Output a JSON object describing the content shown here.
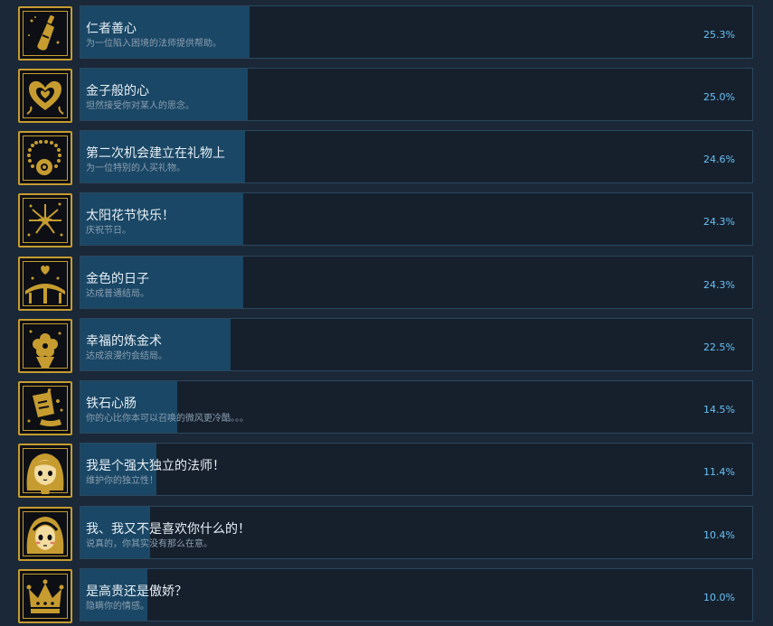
{
  "achievements": [
    {
      "title": "仁者善心",
      "description": "为一位陷入困境的法师提供帮助。",
      "percent": "25.3%",
      "progress": 25.3,
      "icon": "wine-bottle-icon"
    },
    {
      "title": "金子般的心",
      "description": "坦然接受你对某人的思念。",
      "percent": "25.0%",
      "progress": 25.0,
      "icon": "golden-heart-icon"
    },
    {
      "title": "第二次机会建立在礼物上",
      "description": "为一位特别的人买礼物。",
      "percent": "24.6%",
      "progress": 24.6,
      "icon": "flower-bracelet-icon"
    },
    {
      "title": "太阳花节快乐！",
      "description": "庆祝节日。",
      "percent": "24.3%",
      "progress": 24.3,
      "icon": "fireworks-icon"
    },
    {
      "title": "金色的日子",
      "description": "达成普通结局。",
      "percent": "24.3%",
      "progress": 24.3,
      "icon": "bridge-heart-icon"
    },
    {
      "title": "幸福的炼金术",
      "description": "达成浪漫约会结局。",
      "percent": "22.5%",
      "progress": 22.5,
      "icon": "flower-bouquet-icon"
    },
    {
      "title": "铁石心肠",
      "description": "你的心比你本可以召唤的微风更冷酷。。。",
      "percent": "14.5%",
      "progress": 14.5,
      "icon": "spilled-drink-icon"
    },
    {
      "title": "我是个强大独立的法师！",
      "description": "维护你的独立性！",
      "percent": "11.4%",
      "progress": 11.4,
      "icon": "girl-portrait-icon"
    },
    {
      "title": "我、我又不是喜欢你什么的！",
      "description": "说真的，你其实没有那么在意。",
      "percent": "10.4%",
      "progress": 10.4,
      "icon": "blushing-girl-icon"
    },
    {
      "title": "是高贵还是傲娇？",
      "description": "隐瞒你的情感。",
      "percent": "10.0%",
      "progress": 10.0,
      "icon": "crown-icon"
    }
  ],
  "colors": {
    "accent_gold": "#c69c30",
    "progress_fill": "#1a4765",
    "percent_text": "#67c1f5"
  }
}
